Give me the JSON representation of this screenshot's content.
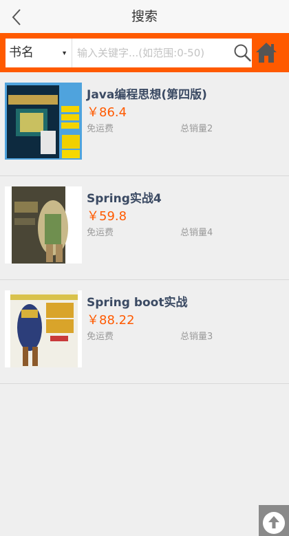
{
  "header": {
    "title": "搜索",
    "back_icon": "chevron-left-icon"
  },
  "search": {
    "field_select": "书名",
    "placeholder": "输入关键字...(如范围:0-50)",
    "value": "",
    "search_icon": "search-icon",
    "home_icon": "home-icon"
  },
  "products": [
    {
      "title": "Java编程思想(第四版)",
      "price": "￥86.4",
      "shipping": "免运费",
      "sales": "总销量2"
    },
    {
      "title": "Spring实战4",
      "price": "￥59.8",
      "shipping": "免运费",
      "sales": "总销量4"
    },
    {
      "title": "Spring boot实战",
      "price": "￥88.22",
      "shipping": "免运费",
      "sales": "总销量3"
    }
  ],
  "scroll_top_icon": "arrow-up-icon",
  "colors": {
    "accent": "#ff5a00",
    "title_text": "#3b4a63",
    "background": "#efefef"
  }
}
